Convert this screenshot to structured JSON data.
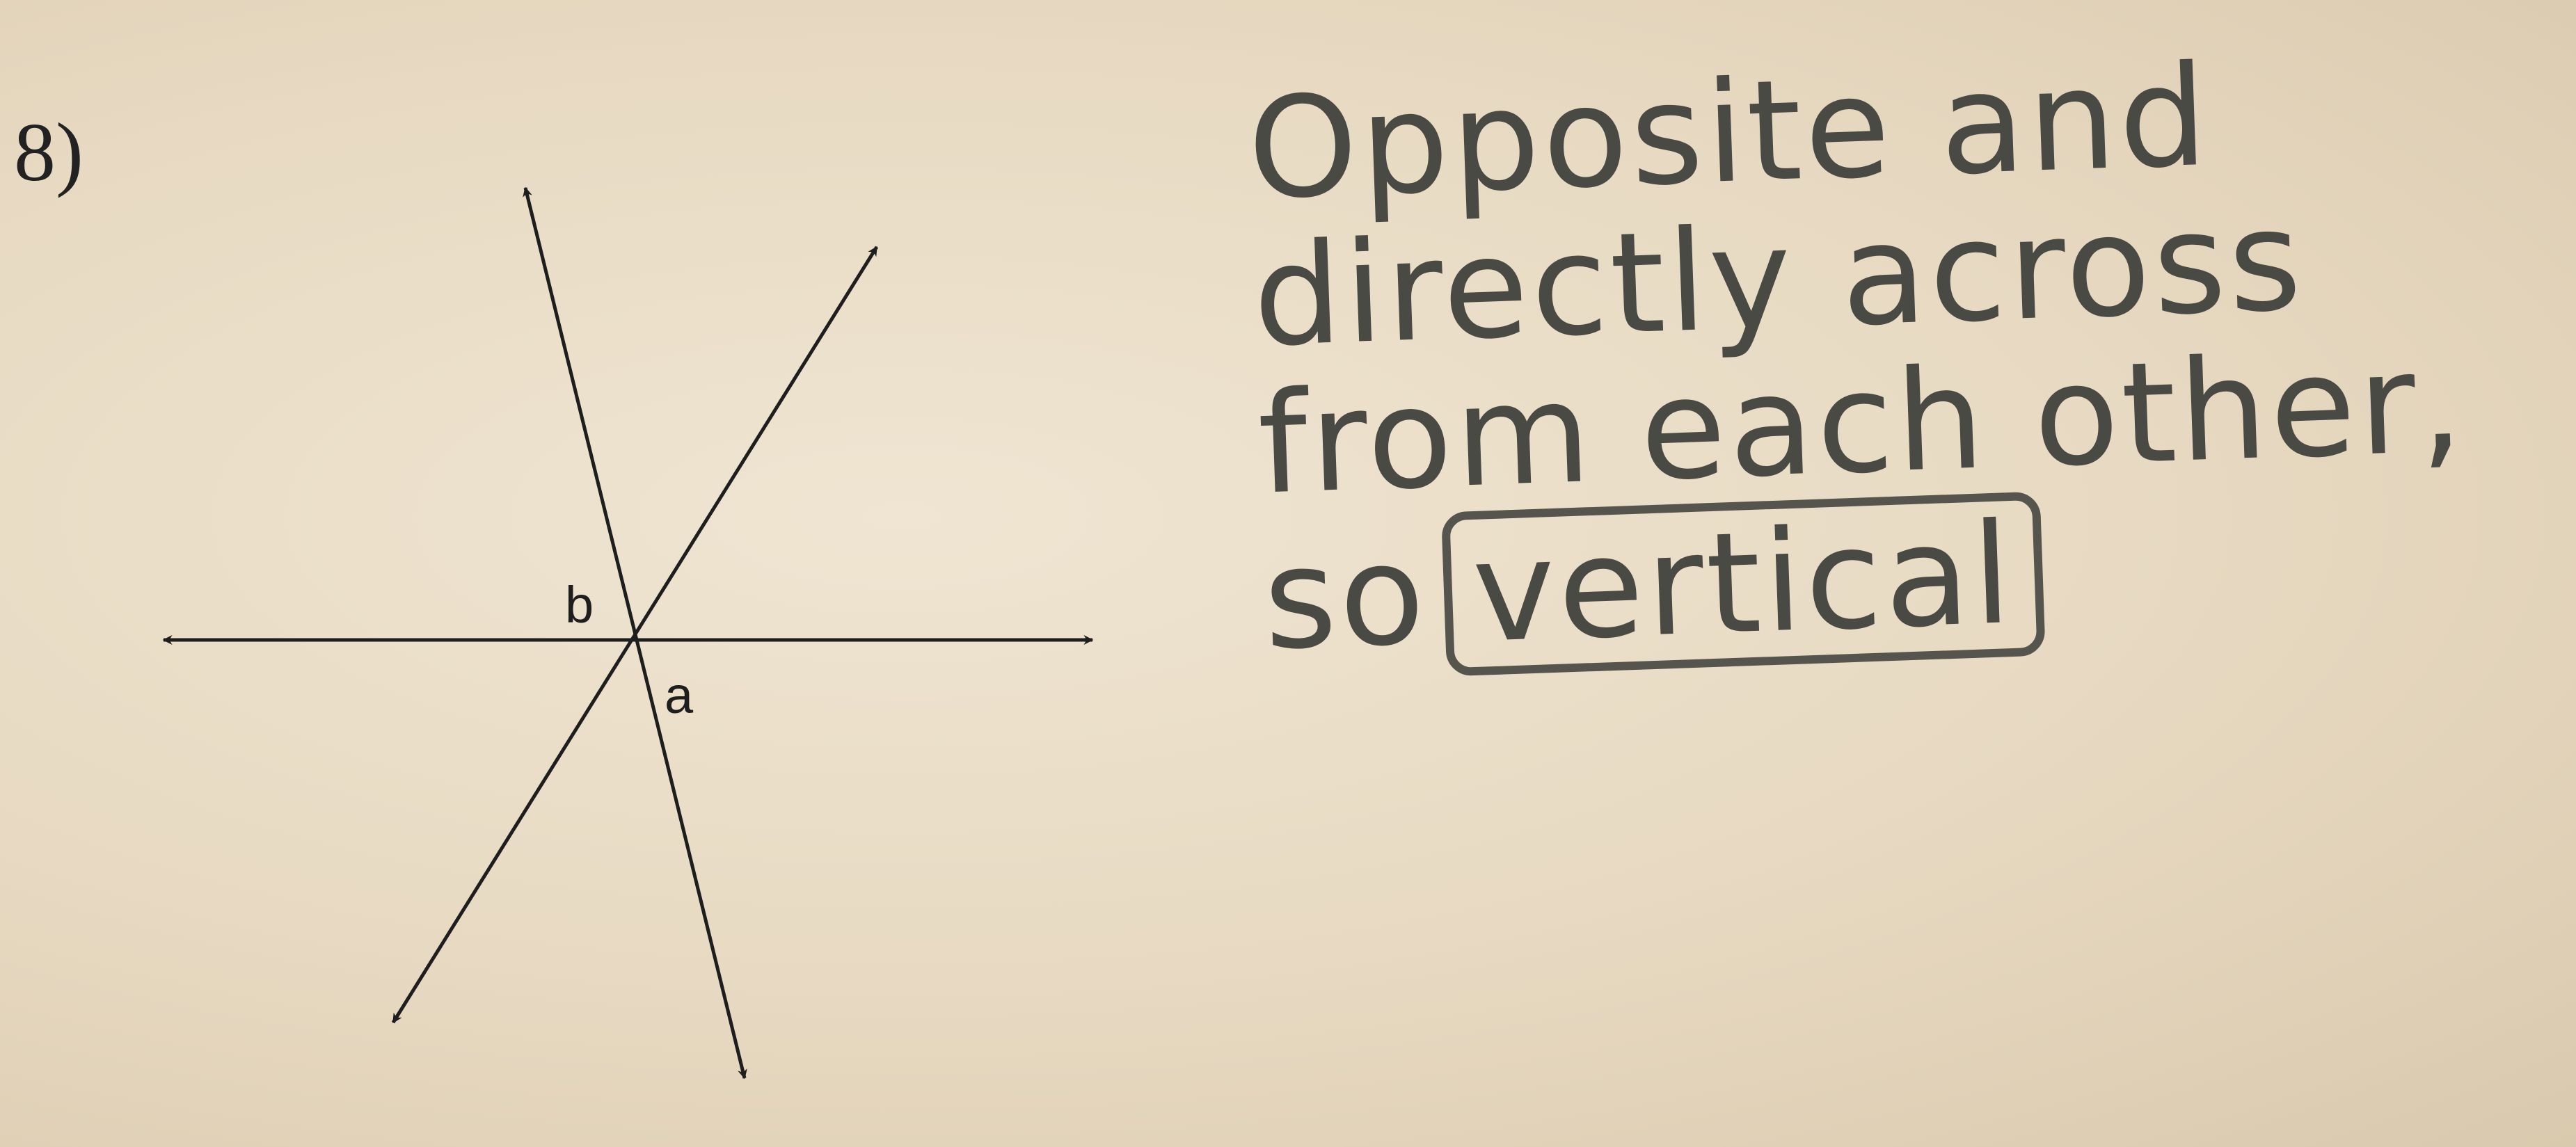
{
  "problem": {
    "number": "8)"
  },
  "diagram": {
    "angle_labels": {
      "b": "b",
      "a": "a"
    }
  },
  "answer": {
    "line1": "Opposite and",
    "line2": "directly across",
    "line3": "from each other,",
    "line4_prefix": "so",
    "boxed_word": "vertical"
  },
  "colors": {
    "paper": "#e9dcc6",
    "ink": "#1e1e1e",
    "pencil": "#4a4a44"
  }
}
